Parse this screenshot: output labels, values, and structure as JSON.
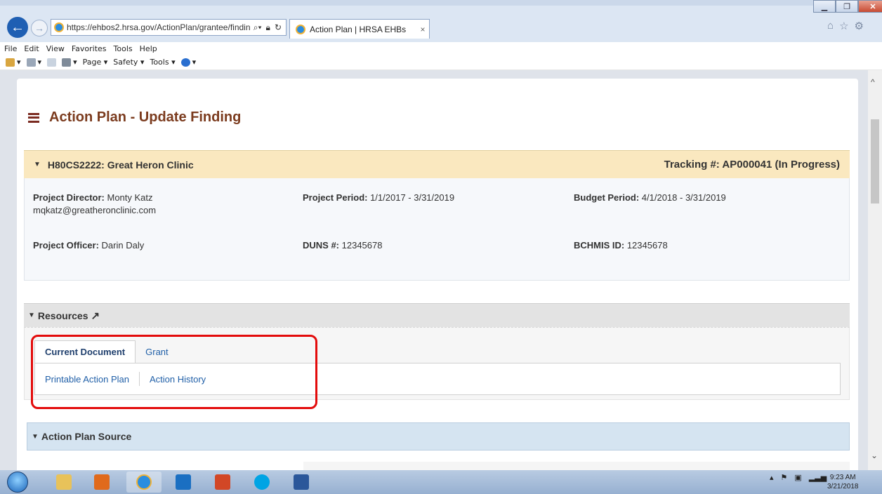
{
  "browser": {
    "address_url": "https://ehbos2.hrsa.gov/ActionPlan/grantee/findin",
    "tab_title": "Action Plan | HRSA EHBs",
    "tab_close": "×",
    "menu": [
      "File",
      "Edit",
      "View",
      "Favorites",
      "Tools",
      "Help"
    ],
    "command_bar": {
      "page": "Page ▾",
      "safety": "Safety ▾",
      "tools": "Tools ▾"
    }
  },
  "page": {
    "title": "Action Plan - Update Finding",
    "grantee": {
      "name": "H80CS2222: Great Heron Clinic",
      "tracking": "Tracking #: AP000041 (In Progress)"
    },
    "details": {
      "project_director_label": "Project Director:",
      "project_director_value": " Monty Katz",
      "project_director_email": "mqkatz@greatheronclinic.com",
      "project_period_label": "Project Period:",
      "project_period_value": " 1/1/2017 - 3/31/2019",
      "budget_period_label": "Budget Period:",
      "budget_period_value": " 4/1/2018 - 3/31/2019",
      "project_officer_label": "Project Officer:",
      "project_officer_value": " Darin Daly",
      "duns_label": "DUNS #:",
      "duns_value": " 12345678",
      "bchmis_label": "BCHMIS ID:",
      "bchmis_value": " 12345678"
    },
    "resources": {
      "label": "Resources",
      "tabs": [
        {
          "label": "Current Document",
          "active": true
        },
        {
          "label": "Grant",
          "active": false
        }
      ],
      "links": [
        "Printable Action Plan",
        "Action History"
      ]
    },
    "action_plan_source": {
      "label": "Action Plan Source"
    }
  },
  "taskbar": {
    "clock_time": "9:23 AM",
    "clock_date": "3/21/2018"
  },
  "colors": {
    "title": "#7b3b1e",
    "grantee_header_bg": "#fae8bf",
    "link": "#2160a8",
    "highlight": "#e30b0b",
    "source_header_bg": "#d5e4f1"
  },
  "icons": {
    "back": "back-arrow-icon",
    "forward": "forward-arrow-icon",
    "search": "search-icon",
    "lock": "lock-icon",
    "refresh": "refresh-icon",
    "page_menu": "hamburger-icon",
    "external": "external-link-icon"
  }
}
